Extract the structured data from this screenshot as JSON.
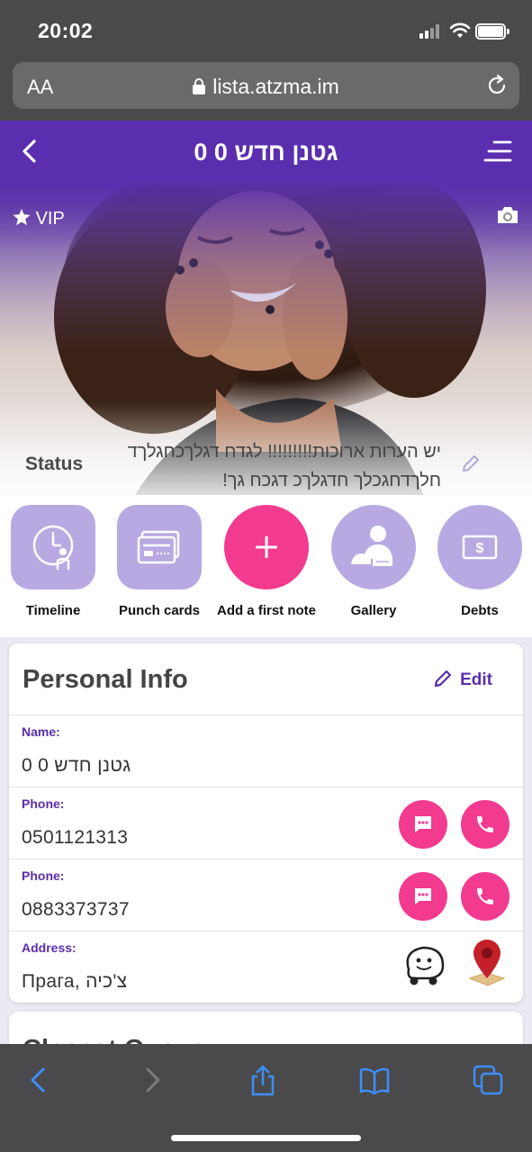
{
  "status_bar": {
    "time": "20:02"
  },
  "browser": {
    "text_size_label": "AA",
    "url": "lista.atzma.im"
  },
  "header": {
    "title": "גטנן חדש 0 0"
  },
  "hero": {
    "vip_label": "VIP",
    "status_label": "Status",
    "status_text": "יש הערות ארוכות!!!!!!!!! לגדח דגלךכחגלךד חלךדחגכלך חדגלךכ דגכח גך!"
  },
  "actions": [
    {
      "label": "Timeline",
      "icon": "timeline-icon"
    },
    {
      "label": "Punch cards",
      "icon": "punch-card-icon"
    },
    {
      "label": "Add a first note",
      "icon": "plus-icon"
    },
    {
      "label": "Gallery",
      "icon": "gallery-icon"
    },
    {
      "label": "Debts",
      "icon": "dollar-icon"
    }
  ],
  "personal_info": {
    "title": "Personal Info",
    "edit_label": "Edit",
    "fields": [
      {
        "label": "Name:",
        "value": "גטנן חדש 0 0"
      },
      {
        "label": "Phone:",
        "value": "0501121313"
      },
      {
        "label": "Phone:",
        "value": "0883373737"
      },
      {
        "label": "Address:",
        "value": "Прага, צ'כיה"
      }
    ]
  },
  "next_card": {
    "title": "Closest Queue"
  },
  "colors": {
    "primary": "#5a2eae",
    "accent": "#f23a8f",
    "action_bg": "#b9a9e2",
    "browser_chrome": "#4a4a4c"
  }
}
